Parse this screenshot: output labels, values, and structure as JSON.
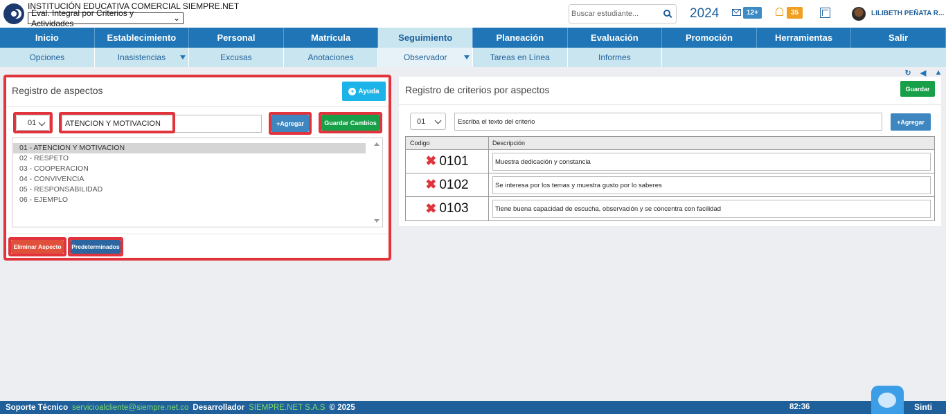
{
  "header": {
    "institution": "INSTITUCIÓN EDUCATIVA COMERCIAL SIEMPRE.NET",
    "module_select": "Eval. Integral por Criterios y Actividades",
    "search_placeholder": "Buscar estudiante...",
    "year": "2024",
    "messages_badge": "12+",
    "notifications_badge": "35",
    "user_name": "LILIBETH PEÑATA R..."
  },
  "nav": {
    "main": [
      "Inicio",
      "Establecimiento",
      "Personal",
      "Matrícula",
      "Seguimiento",
      "Planeación",
      "Evaluación",
      "Promoción",
      "Herramientas",
      "Salir"
    ],
    "sub": [
      "Opciones",
      "Inasistencias",
      "Excusas",
      "Anotaciones",
      "Observador",
      "Tareas en Línea",
      "Informes"
    ]
  },
  "left_panel": {
    "title": "Registro de aspectos",
    "help_label": "Ayuda",
    "code_select": "01",
    "aspect_input": "ATENCION Y MOTIVACION",
    "add_label": "Agregar",
    "save_changes_label": "Guardar Cambios",
    "aspects": [
      "01 - ATENCION Y MOTIVACION",
      "02 - RESPETO",
      "03 - COOPERACION",
      "04 - CONVIVENCIA",
      "05 - RESPONSABILIDAD",
      "06 - EJEMPLO"
    ],
    "delete_label": "Eliminar Aspecto",
    "defaults_label": "Predeterminados"
  },
  "right_panel": {
    "title": "Registro de criterios por aspectos",
    "save_label": "Guardar",
    "code_select": "01",
    "criterion_placeholder": "Escriba el texto del criterio",
    "add_label": "Agregar",
    "table_headers": {
      "code": "Codigo",
      "description": "Descripción"
    },
    "rows": [
      {
        "code": "0101",
        "description": "Muestra dedicación y constancia"
      },
      {
        "code": "0102",
        "description": "Se interesa por los temas y muestra gusto por lo saberes"
      },
      {
        "code": "0103",
        "description": "Tiene buena capacidad de escucha, observación y se concentra con facilidad"
      }
    ]
  },
  "footer": {
    "support_label": "Soporte Técnico",
    "support_email": "servicioalcliente@siempre.net.co",
    "developer_label": "Desarrollador",
    "developer_name": "SIEMPRE.NET S.A.S",
    "copyright": "© 2025",
    "timer": "82:36",
    "brand": "Sinti"
  },
  "colors": {
    "nav_blue": "#1f75b5",
    "subnav": "#c9e6f0",
    "highlight_red": "#e0333c",
    "save_green": "#17a048",
    "help_cyan": "#1cb3e8"
  }
}
